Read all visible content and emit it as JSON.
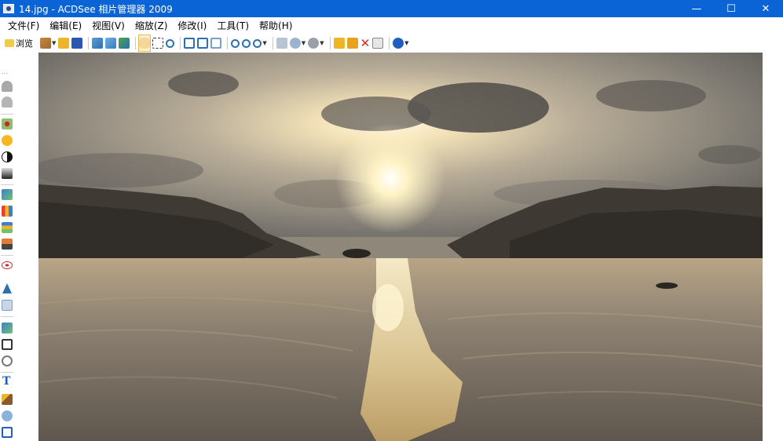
{
  "window": {
    "title": "14.jpg - ACDSee 相片管理器 2009",
    "minimize": "—",
    "maximize": "☐",
    "close": "✕"
  },
  "menu": [
    "文件(F)",
    "编辑(E)",
    "视图(V)",
    "缩放(Z)",
    "修改(I)",
    "工具(T)",
    "帮助(H)"
  ],
  "toolbar": {
    "browse_label": "浏览"
  },
  "colors": {
    "titlebar": "#0a64d6",
    "accent_yellow": "#f0b429",
    "delete_red": "#d9261c"
  }
}
